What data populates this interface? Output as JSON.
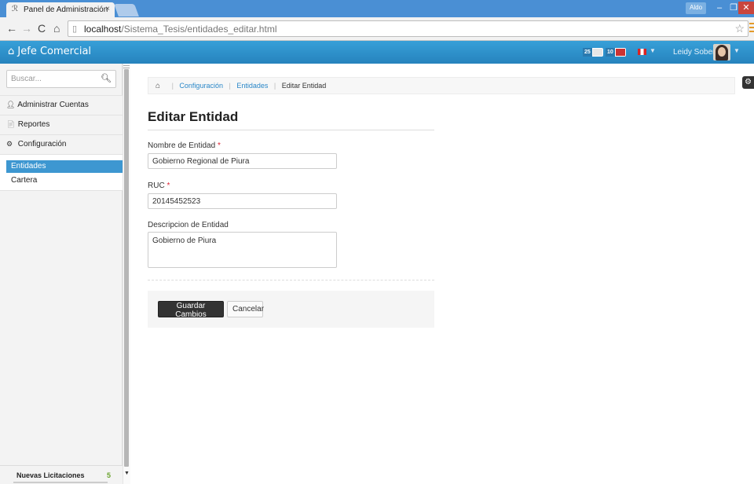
{
  "browser": {
    "tab_title": "Panel de Administración",
    "tab_close": "×",
    "url_host": "localhost",
    "url_path": "/Sistema_Tesis/entidades_editar.html",
    "window_user": "Aldo"
  },
  "navbar": {
    "brand": "Jefe Comercial",
    "badge1_count": "25",
    "badge2_count": "10",
    "user_name": "Leidy Soberón"
  },
  "sidebar": {
    "search_placeholder": "Buscar...",
    "items": [
      {
        "label": "Administrar Cuentas",
        "icon": "user-icon"
      },
      {
        "label": "Reportes",
        "icon": "document-icon"
      },
      {
        "label": "Configuración",
        "icon": "gear-icon"
      }
    ],
    "subitems": [
      {
        "label": "Entidades",
        "active": true
      },
      {
        "label": "Cartera",
        "active": false
      }
    ],
    "footer": {
      "label": "Nuevas Licitaciones",
      "count": "5"
    }
  },
  "breadcrumb": {
    "items": [
      "Configuración",
      "Entidades"
    ],
    "current": "Editar Entidad"
  },
  "form": {
    "title": "Editar Entidad",
    "fields": [
      {
        "label": "Nombre de Entidad",
        "required": "*",
        "value": "Gobierno Regional de Piura"
      },
      {
        "label": "RUC",
        "required": "*",
        "value": "20145452523"
      },
      {
        "label": "Descripcion de Entidad",
        "value": "Gobierno de Piura"
      }
    ],
    "save_label": "Guardar Cambios",
    "cancel_label": "Cancelar"
  },
  "colors": {
    "navbar": "#2b8fc9",
    "active_item": "#3d97d1",
    "link": "#2a87c8",
    "required": "#d22233",
    "primary_button": "#333333"
  }
}
